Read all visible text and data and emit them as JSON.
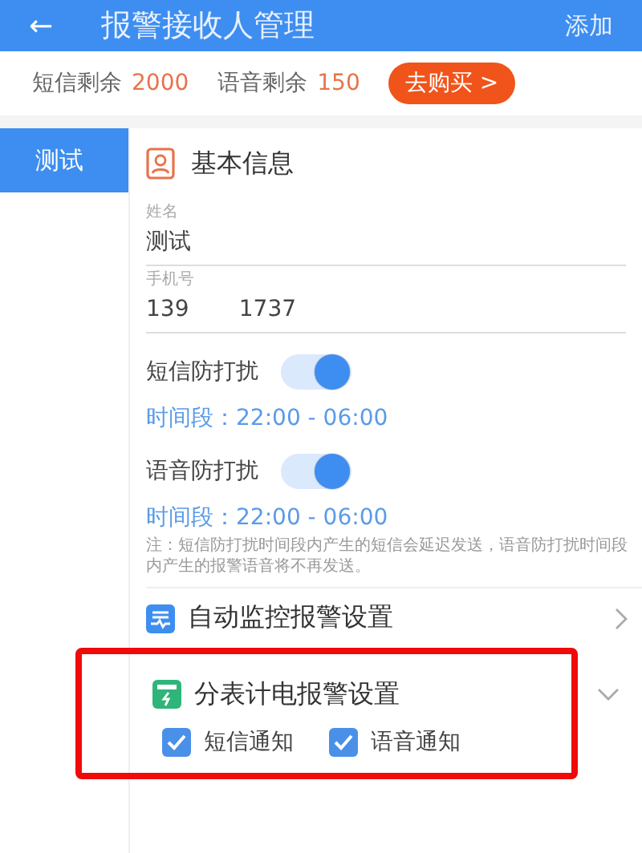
{
  "header": {
    "back": "←",
    "title": "报警接收人管理",
    "action": "添加"
  },
  "balance": [
    {
      "label": "短信剩余",
      "value": "2000"
    },
    {
      "label": "语音剩余",
      "value": "150"
    }
  ],
  "buy_button": "去购买 >",
  "sidebar": {
    "items": [
      {
        "label": "测试",
        "selected": true
      }
    ]
  },
  "basic_info": {
    "title": "基本信息",
    "fields": [
      {
        "label": "姓名",
        "value": "测试"
      },
      {
        "label": "手机号",
        "value": "139       1737"
      }
    ]
  },
  "dnd": [
    {
      "label": "短信防打扰",
      "on": true,
      "period": "时间段：22:00 - 06:00"
    },
    {
      "label": "语音防打扰",
      "on": true,
      "period": "时间段：22:00 - 06:00"
    }
  ],
  "note": "注：短信防打扰时间段内产生的短信会延迟发送，语音防打扰时间段内产生的报警语音将不再发送。",
  "sections": [
    {
      "title": "自动监控报警设置",
      "expanded": false,
      "highlighted": false,
      "kind": "monitor"
    },
    {
      "title": "分表计电报警设置",
      "expanded": true,
      "highlighted": true,
      "kind": "meter",
      "options": [
        {
          "label": "短信通知",
          "checked": true
        },
        {
          "label": "语音通知",
          "checked": true
        }
      ]
    }
  ]
}
